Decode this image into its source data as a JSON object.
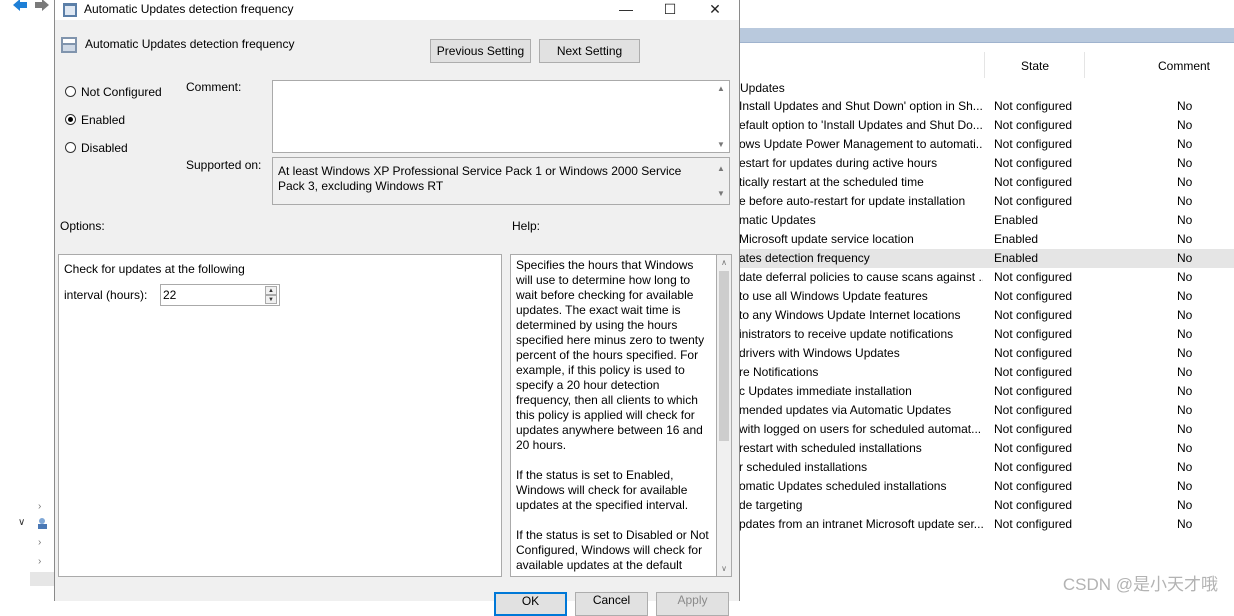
{
  "dialog": {
    "title": "Automatic Updates detection frequency",
    "policy_name": "Automatic Updates detection frequency",
    "previous_label": "Previous Setting",
    "next_label": "Next Setting",
    "radio_not_configured": "Not Configured",
    "radio_enabled": "Enabled",
    "radio_disabled": "Disabled",
    "selected_radio": "Enabled",
    "comment_label": "Comment:",
    "comment_value": "",
    "supported_label": "Supported on:",
    "supported_value": "At least Windows XP Professional Service Pack 1 or Windows 2000 Service Pack 3, excluding Windows RT",
    "options_label": "Options:",
    "help_label": "Help:",
    "options_line1": "Check for updates at the following",
    "interval_label": "interval (hours):",
    "interval_value": "22",
    "help_paragraphs": [
      "Specifies the hours that Windows will use to determine how long to wait before checking for available updates. The exact wait time is determined by using the hours specified here minus zero to twenty percent of the hours specified. For example, if this policy is used to specify a 20 hour detection frequency, then all clients to which this policy is applied will check for updates anywhere between 16 and 20 hours.",
      "If the status is set to Enabled, Windows will check for available updates at the specified interval.",
      "If the status is set to Disabled or Not Configured, Windows will check for available updates at the default"
    ],
    "ok_label": "OK",
    "cancel_label": "Cancel",
    "apply_label": "Apply"
  },
  "background": {
    "columns": {
      "state": "State",
      "comment": "Comment"
    },
    "group_label": "Updates",
    "rows": [
      {
        "name": "Install Updates and Shut Down' option in Sh...",
        "state": "Not configured",
        "comment": "No"
      },
      {
        "name": "efault option to 'Install Updates and Shut Do...",
        "state": "Not configured",
        "comment": "No"
      },
      {
        "name": "ows Update Power Management to automati...",
        "state": "Not configured",
        "comment": "No"
      },
      {
        "name": "estart for updates during active hours",
        "state": "Not configured",
        "comment": "No"
      },
      {
        "name": "tically restart at the scheduled time",
        "state": "Not configured",
        "comment": "No"
      },
      {
        "name": "e before auto-restart for update installation",
        "state": "Not configured",
        "comment": "No"
      },
      {
        "name": "matic Updates",
        "state": "Enabled",
        "comment": "No"
      },
      {
        "name": " Microsoft update service location",
        "state": "Enabled",
        "comment": "No"
      },
      {
        "name": "ates detection frequency",
        "state": "Enabled",
        "comment": "No",
        "selected": true
      },
      {
        "name": "date deferral policies to cause scans against ...",
        "state": "Not configured",
        "comment": "No"
      },
      {
        "name": "to use all Windows Update features",
        "state": "Not configured",
        "comment": "No"
      },
      {
        "name": " to any Windows Update Internet locations",
        "state": "Not configured",
        "comment": "No"
      },
      {
        "name": "inistrators to receive update notifications",
        "state": "Not configured",
        "comment": "No"
      },
      {
        "name": "drivers with Windows Updates",
        "state": "Not configured",
        "comment": "No"
      },
      {
        "name": "re Notifications",
        "state": "Not configured",
        "comment": "No"
      },
      {
        "name": "c Updates immediate installation",
        "state": "Not configured",
        "comment": "No"
      },
      {
        "name": "mended updates via Automatic Updates",
        "state": "Not configured",
        "comment": "No"
      },
      {
        "name": " with logged on users for scheduled automat...",
        "state": "Not configured",
        "comment": "No"
      },
      {
        "name": "restart with scheduled installations",
        "state": "Not configured",
        "comment": "No"
      },
      {
        "name": "r scheduled installations",
        "state": "Not configured",
        "comment": "No"
      },
      {
        "name": "omatic Updates scheduled installations",
        "state": "Not configured",
        "comment": "No"
      },
      {
        "name": "de targeting",
        "state": "Not configured",
        "comment": "No"
      },
      {
        "name": "pdates from an intranet Microsoft update ser...",
        "state": "Not configured",
        "comment": "No"
      }
    ],
    "watermark": "CSDN @是小天才哦"
  }
}
